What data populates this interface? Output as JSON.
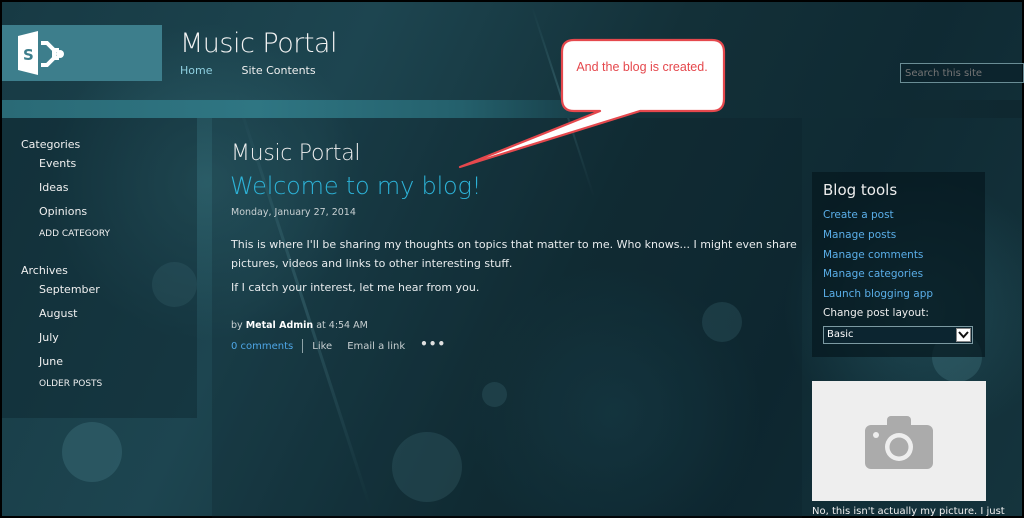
{
  "header": {
    "site_title": "Music Portal",
    "nav": [
      {
        "label": "Home"
      },
      {
        "label": "Site Contents"
      }
    ],
    "search_placeholder": "Search this site",
    "logo_icon": "sharepoint-logo-icon"
  },
  "leftnav": {
    "categories": {
      "title": "Categories",
      "items": [
        "Events",
        "Ideas",
        "Opinions"
      ],
      "action": "ADD CATEGORY"
    },
    "archives": {
      "title": "Archives",
      "items": [
        "September",
        "August",
        "July",
        "June"
      ],
      "action": "OLDER POSTS"
    }
  },
  "post": {
    "blog_name": "Music Portal",
    "title": "Welcome to my blog!",
    "date": "Monday, January 27, 2014",
    "paragraphs": [
      "This is where I'll be sharing my thoughts on topics that matter to me. Who knows... I might even share pictures, videos and links to other interesting stuff.",
      "If I catch your interest, let me hear from you."
    ],
    "byline_prefix": "by",
    "author": "Metal Admin",
    "time": "at 4:54 AM",
    "comments": "0 comments",
    "like": "Like",
    "email": "Email a link",
    "more": "•••"
  },
  "blog_tools": {
    "title": "Blog tools",
    "links": [
      "Create a post",
      "Manage posts",
      "Manage comments",
      "Manage categories",
      "Launch blogging app"
    ],
    "layout_label": "Change post layout:",
    "layout_value": "Basic"
  },
  "photo": {
    "icon": "camera-icon",
    "caption": "No, this isn't actually my picture. I just"
  },
  "callout": {
    "text": "And the blog is created.",
    "border_color": "#e5484d"
  }
}
